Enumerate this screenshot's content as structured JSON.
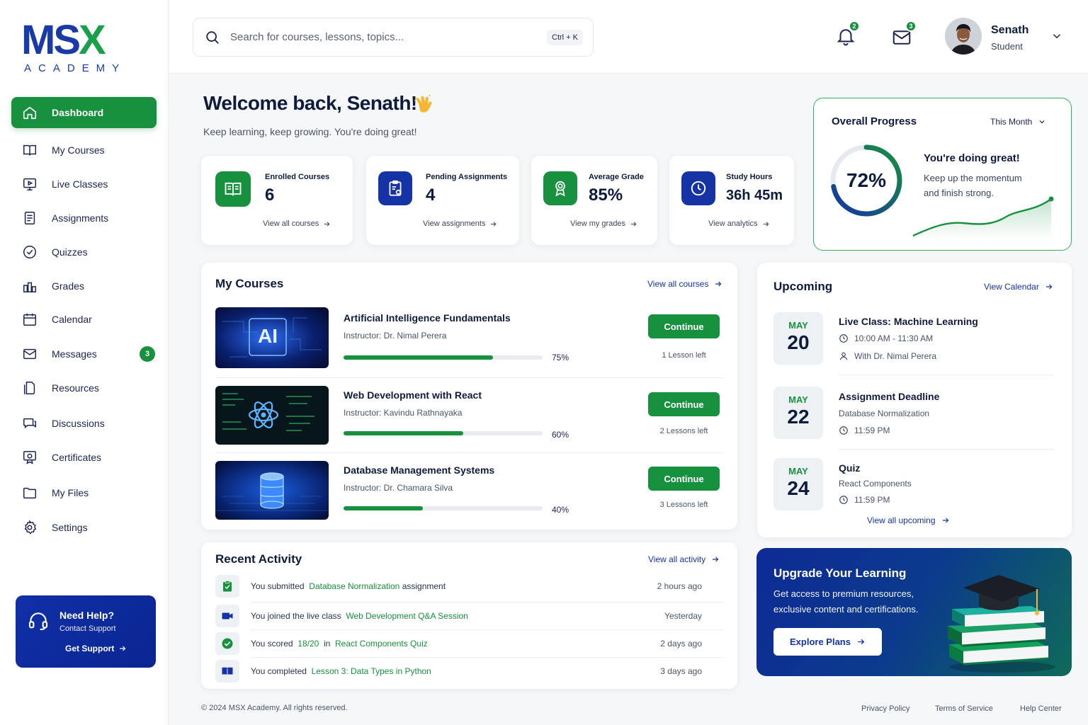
{
  "brand": {
    "name_part1": "MSX",
    "name_part2": "",
    "tagline": "ACADEMY"
  },
  "sidebar": {
    "items": [
      {
        "label": "Dashboard",
        "icon": "home-icon",
        "active": true
      },
      {
        "label": "My Courses",
        "icon": "book-icon"
      },
      {
        "label": "Live Classes",
        "icon": "monitor-play-icon"
      },
      {
        "label": "Assignments",
        "icon": "document-icon"
      },
      {
        "label": "Quizzes",
        "icon": "check-circle-icon"
      },
      {
        "label": "Grades",
        "icon": "chart-icon"
      },
      {
        "label": "Calendar",
        "icon": "calendar-icon"
      },
      {
        "label": "Messages",
        "icon": "mail-icon",
        "badge": "3"
      },
      {
        "label": "Resources",
        "icon": "files-icon"
      },
      {
        "label": "Discussions",
        "icon": "chat-icon"
      },
      {
        "label": "Certificates",
        "icon": "certificate-icon"
      },
      {
        "label": "My Files",
        "icon": "folder-icon"
      },
      {
        "label": "Settings",
        "icon": "gear-icon"
      }
    ],
    "help": {
      "title": "Need Help?",
      "subtitle": "Contact Support",
      "button": "Get Support"
    }
  },
  "topbar": {
    "search_placeholder": "Search for courses, lessons, topics...",
    "shortcut": "Ctrl + K",
    "notifications_count": "2",
    "messages_count": "3",
    "user_name": "Senath",
    "user_role": "Student"
  },
  "welcome": {
    "title": "Welcome back, Senath!",
    "subtitle": "Keep learning, keep growing. You're doing great!"
  },
  "stats": [
    {
      "label": "Enrolled Courses",
      "value": "6",
      "link": "View all courses",
      "icon": "book-open-icon",
      "color": "#17913e"
    },
    {
      "label": "Pending Assignments",
      "value": "4",
      "link": "View assignments",
      "icon": "clipboard-icon",
      "color": "#1533a5"
    },
    {
      "label": "Average Grade",
      "value": "85%",
      "link": "View my grades",
      "icon": "award-icon",
      "color": "#17913e"
    },
    {
      "label": "Study Hours",
      "value": "36h 45m",
      "link": "View analytics",
      "icon": "clock-icon",
      "color": "#1533a5"
    }
  ],
  "progress": {
    "title": "Overall Progress",
    "period": "This Month",
    "value_label": "72%",
    "value": 0.72,
    "headline": "You're doing great!",
    "text": "Keep up the momentum and finish strong."
  },
  "courses": {
    "title": "My Courses",
    "link": "View all courses",
    "continue_label": "Continue",
    "items": [
      {
        "name": "Artificial Intelligence Fundamentals",
        "instructor": "Instructor: Dr. Nimal Perera",
        "progress_label": "75%",
        "progress": 0.75,
        "lessons_left": "1 Lesson left",
        "thumb_text": "AI"
      },
      {
        "name": "Web Development with React",
        "instructor": "Instructor: Kavindu Rathnayaka",
        "progress_label": "60%",
        "progress": 0.6,
        "lessons_left": "2 Lessons left"
      },
      {
        "name": "Database Management Systems",
        "instructor": "Instructor: Dr. Chamara Silva",
        "progress_label": "40%",
        "progress": 0.4,
        "lessons_left": "3 Lessons left"
      }
    ]
  },
  "upcoming": {
    "title": "Upcoming",
    "link": "View Calendar",
    "footer_link": "View all upcoming",
    "items": [
      {
        "month": "MAY",
        "day": "20",
        "title": "Live Class: Machine Learning",
        "line1": "10:00 AM - 11:30 AM",
        "line1_icon": "clock-icon",
        "line2": "With Dr. Nimal Perera",
        "line2_icon": "user-icon"
      },
      {
        "month": "MAY",
        "day": "22",
        "title": "Assignment Deadline",
        "line1": "Database Normalization",
        "line2": "11:59 PM",
        "line2_icon": "clock-icon"
      },
      {
        "month": "MAY",
        "day": "24",
        "title": "Quiz",
        "line1": "React Components",
        "line2": "11:59 PM",
        "line2_icon": "clock-icon"
      }
    ]
  },
  "activity": {
    "title": "Recent Activity",
    "link": "View all activity",
    "items": [
      {
        "pre": "You submitted",
        "highlight": "Database Normalization",
        "post": "assignment",
        "time": "2 hours ago",
        "icon": "clipboard-check-icon"
      },
      {
        "pre": "You joined the live class",
        "highlight": "Web Development Q&A Session",
        "post": "",
        "time": "Yesterday",
        "icon": "video-icon"
      },
      {
        "pre": "You scored",
        "highlight": "18/20",
        "mid": "in",
        "highlight2": "React Components Quiz",
        "post": "",
        "time": "2 days ago",
        "icon": "check-badge-icon"
      },
      {
        "pre": "You completed",
        "highlight": "Lesson 3: Data Types in Python",
        "post": "",
        "time": "3 days ago",
        "icon": "book-open-icon"
      }
    ]
  },
  "upgrade": {
    "title": "Upgrade Your Learning",
    "text": "Get access to premium resources, exclusive content and certifications.",
    "button": "Explore Plans"
  },
  "footer": {
    "copyright": "© 2024 MSX Academy. All rights reserved.",
    "links": [
      "Privacy Policy",
      "Terms of Service",
      "Help Center"
    ]
  },
  "colors": {
    "accent_green": "#17913e",
    "brand_blue": "#1533a5"
  }
}
